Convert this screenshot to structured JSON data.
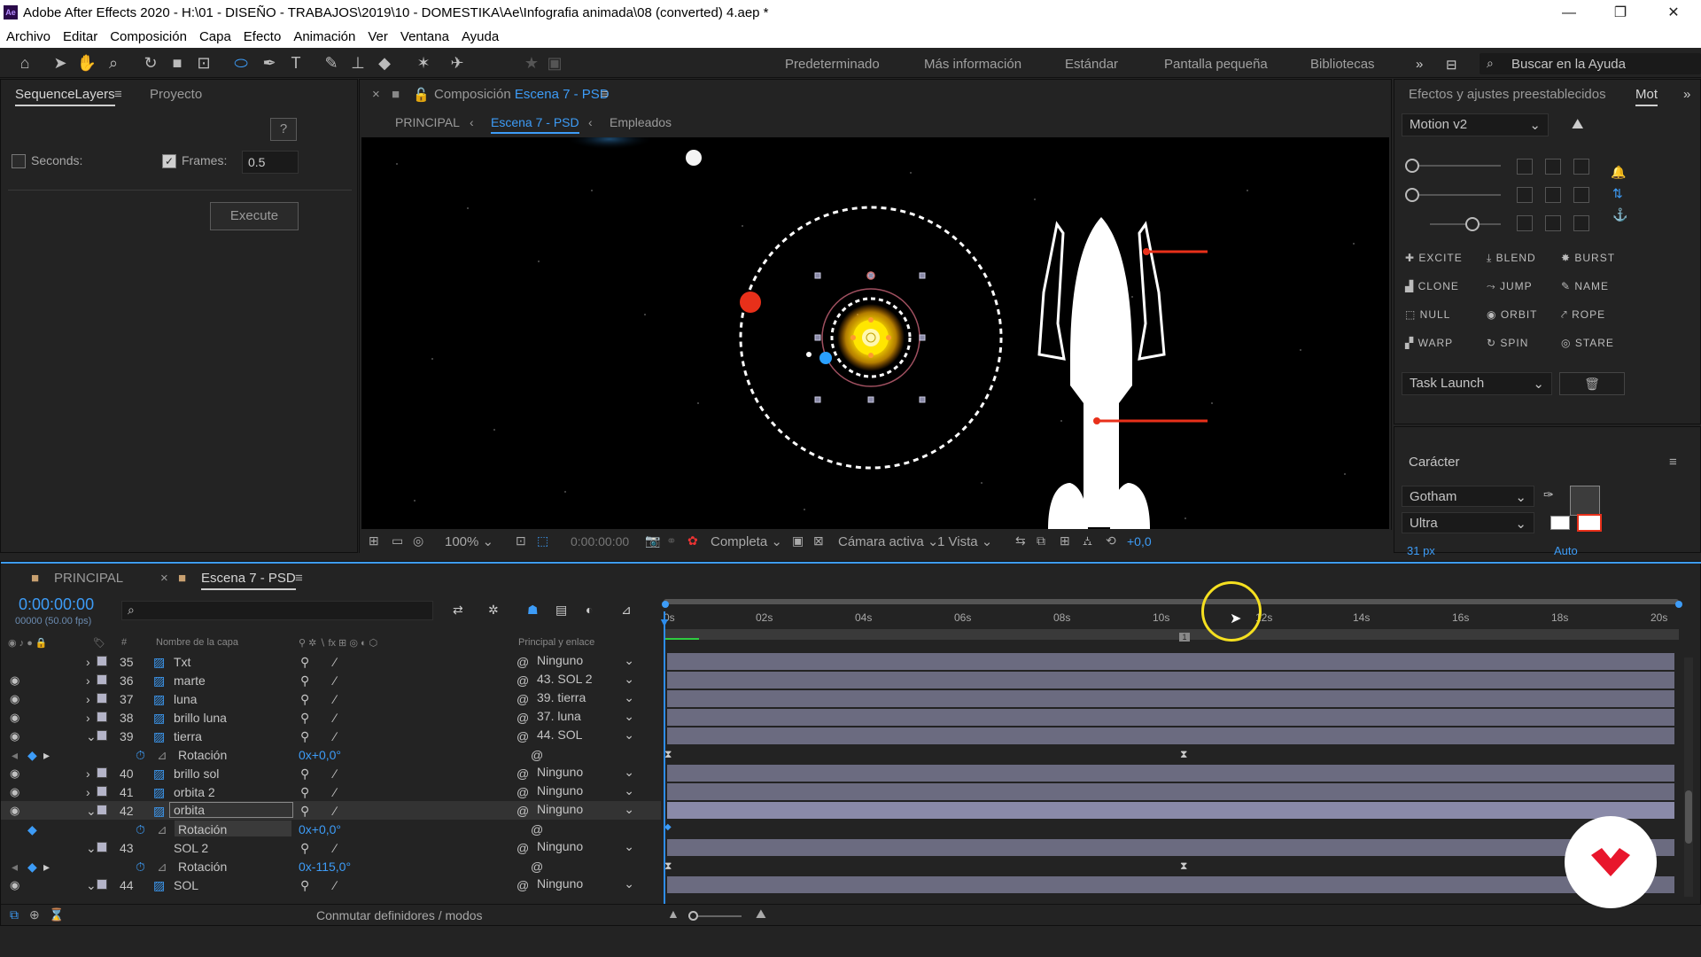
{
  "window": {
    "title": "Adobe After Effects 2020 - H:\\01 - DISEÑO - TRABAJOS\\2019\\10 - DOMESTIKA\\Ae\\Infografia animada\\08 (converted) 4.aep *",
    "app_icon": "Ae"
  },
  "menu": [
    "Archivo",
    "Editar",
    "Composición",
    "Capa",
    "Efecto",
    "Animación",
    "Ver",
    "Ventana",
    "Ayuda"
  ],
  "workspaces": [
    "Predeterminado",
    "Más información",
    "Estándar",
    "Pantalla pequeña",
    "Bibliotecas"
  ],
  "help_placeholder": "Buscar en la Ayuda",
  "left_panel": {
    "tabs": [
      "SequenceLayers",
      "Proyecto"
    ],
    "help_btn": "?",
    "seconds_label": "Seconds:",
    "frames_label": "Frames:",
    "frames_value": "0.5",
    "execute": "Execute"
  },
  "comp_panel": {
    "tab_prefix": "Composición",
    "tab_name": "Escena 7 - PSD",
    "crumbs": [
      "PRINCIPAL",
      "Escena 7 - PSD",
      "Empleados"
    ],
    "zoom": "100%",
    "timecode": "0:00:00:00",
    "resolution": "Completa",
    "camera": "Cámara activa",
    "views": "1 Vista",
    "exposure": "+0,0"
  },
  "effects_panel": {
    "tabs": [
      "Efectos y ajustes preestablecidos",
      "Mot"
    ],
    "preset": "Motion v2",
    "buttons": [
      "EXCITE",
      "BLEND",
      "BURST",
      "CLONE",
      "JUMP",
      "NAME",
      "NULL",
      "ORBIT",
      "ROPE",
      "WARP",
      "SPIN",
      "STARE"
    ],
    "task": "Task Launch"
  },
  "character_panel": {
    "title": "Carácter",
    "font": "Gotham",
    "style": "Ultra",
    "size": "31 px",
    "leading": "Auto"
  },
  "timeline": {
    "tabs": [
      "PRINCIPAL",
      "Escena 7 - PSD"
    ],
    "timecode": "0:00:00:00",
    "fps": "00000 (50.00 fps)",
    "col_hash": "#",
    "col_name": "Nombre de la capa",
    "col_parent": "Principal y enlace",
    "ruler": [
      "0s",
      "02s",
      "04s",
      "06s",
      "08s",
      "10s",
      "12s",
      "14s",
      "16s",
      "18s",
      "20s"
    ],
    "footer": "Conmutar definidores / modos",
    "layers": [
      {
        "num": "35",
        "name": "Txt",
        "parent": "Ninguno"
      },
      {
        "num": "36",
        "name": "marte",
        "parent": "43. SOL 2"
      },
      {
        "num": "37",
        "name": "luna",
        "parent": "39. tierra"
      },
      {
        "num": "38",
        "name": "brillo luna",
        "parent": "37. luna"
      },
      {
        "num": "39",
        "name": "tierra",
        "parent": "44. SOL"
      },
      {
        "prop": "Rotación",
        "value": "0x+0,0°"
      },
      {
        "num": "40",
        "name": "brillo sol",
        "parent": "Ninguno"
      },
      {
        "num": "41",
        "name": "orbita 2",
        "parent": "Ninguno"
      },
      {
        "num": "42",
        "name": "orbita",
        "parent": "Ninguno"
      },
      {
        "prop": "Rotación",
        "value": "0x+0,0°"
      },
      {
        "num": "43",
        "name": "SOL 2",
        "parent": "Ninguno"
      },
      {
        "prop": "Rotación",
        "value": "0x-115,0°"
      },
      {
        "num": "44",
        "name": "SOL",
        "parent": "Ninguno"
      }
    ]
  },
  "colors": {
    "accent": "#3d9cf7",
    "playhead": "#2d8ceb",
    "orbit_red": "#e8301a",
    "sun": "#ffe600",
    "earth": "#2aa0ff",
    "domestika": "#e8162c"
  }
}
